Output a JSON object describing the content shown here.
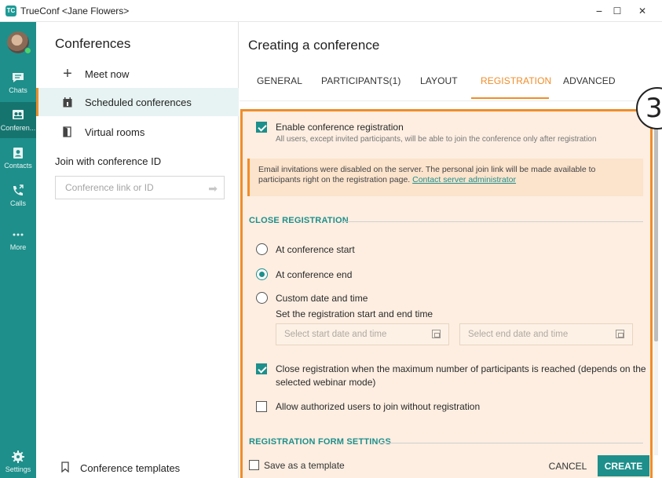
{
  "window": {
    "title": "TrueConf <Jane Flowers>",
    "logo_text": "TC",
    "minimize_icon": "−",
    "maximize_icon": "☐",
    "close_icon": "✕"
  },
  "rail": {
    "items": [
      {
        "label": "Chats",
        "icon": "chat-icon"
      },
      {
        "label": "Conferen...",
        "icon": "conference-icon"
      },
      {
        "label": "Contacts",
        "icon": "contacts-icon"
      },
      {
        "label": "Calls",
        "icon": "calls-icon"
      },
      {
        "label": "More",
        "icon": "more-icon"
      },
      {
        "label": "Settings",
        "icon": "gear-icon"
      }
    ],
    "active": "Conferen..."
  },
  "sidebar": {
    "title": "Conferences",
    "items": [
      {
        "label": "Meet now",
        "icon": "plus-icon"
      },
      {
        "label": "Scheduled conferences",
        "icon": "calendar-icon"
      },
      {
        "label": "Virtual rooms",
        "icon": "door-icon"
      }
    ],
    "join_label": "Join with conference ID",
    "join_placeholder": "Conference link or ID",
    "templates_label": "Conference templates"
  },
  "main": {
    "title": "Creating a conference",
    "tabs": [
      "GENERAL",
      "PARTICIPANTS(1)",
      "LAYOUT",
      "REGISTRATION",
      "ADVANCED"
    ],
    "active_tab": "REGISTRATION",
    "registration": {
      "enable_label": "Enable conference registration",
      "enable_checked": true,
      "enable_sub": "All users, except invited participants, will be able to join the conference only after registration",
      "notice_text": "Email invitations were disabled on the server. The personal join link will be made available to participants right on the registration page.",
      "notice_link": "Contact server administrator",
      "close_section": "CLOSE REGISTRATION",
      "options": [
        {
          "label": "At conference start",
          "checked": false
        },
        {
          "label": "At conference end",
          "checked": true
        },
        {
          "label": "Custom date and time",
          "checked": false
        }
      ],
      "custom_sub": "Set the registration start and end time",
      "start_placeholder": "Select start date and time",
      "end_placeholder": "Select end date and time",
      "max_close_label_1": "Close registration when the maximum number of participants is reached (depends on the",
      "max_close_label_2": "selected webinar mode)",
      "max_close_checked": true,
      "allow_auth_label": "Allow authorized users to join without registration",
      "allow_auth_checked": false,
      "form_section": "REGISTRATION FORM SETTINGS"
    },
    "footer": {
      "save_template_label": "Save as a template",
      "cancel_label": "CANCEL",
      "create_label": "CREATE"
    }
  },
  "annotation": {
    "step": "3"
  },
  "colors": {
    "teal": "#1e8f8b",
    "orange": "#f08d29",
    "highlight_bg": "#fdeee1"
  }
}
